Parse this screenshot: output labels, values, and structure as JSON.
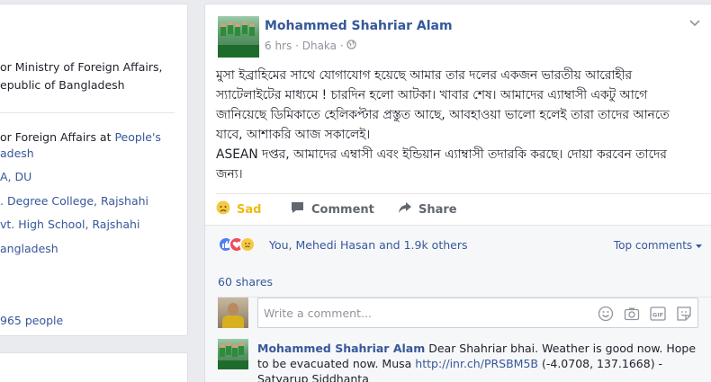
{
  "left_intro": {
    "lines": [
      {
        "text": "or Ministry of Foreign Affairs,",
        "link": ""
      },
      {
        "text": "epublic of Bangladesh",
        "link": ""
      },
      {
        "text": "or Foreign Affairs at ",
        "link": "People's"
      },
      {
        "text": "",
        "link": "adesh"
      },
      {
        "text": "",
        "link": "A, DU"
      },
      {
        "text": "",
        "link": ". Degree College, Rajshahi"
      },
      {
        "text": "",
        "link": "vt. High School, Rajshahi"
      },
      {
        "text": "",
        "link": "angladesh"
      },
      {
        "text": "",
        "link": "965 people"
      }
    ]
  },
  "post": {
    "author": "Mohammed Shahriar Alam",
    "time": "6 hrs",
    "location": "Dhaka",
    "body_lines": [
      "মুসা ইব্রাহিমের সাথে যোগাযোগ হয়েছে আমার তার দলের একজন ভারতীয় আরোহীর",
      "স্যাটেলাইটের মাধ্যমে ! চারদিন হলো আটকা। খাবার শেষ। আমাদের এ্যাম্বাসী একটু আগে",
      "জানিয়েছে ডিমিকাতে হেলিকপ্টার প্রস্তুত আছে, আবহাওয়া ভালো হলেই তারা তাদের আনতে",
      "যাবে, আশাকরি আজ সকালেই।",
      "ASEAN দপ্তর, আমাদের এম্বাসী এবং ইন্ডিয়ান এ্যাম্বাসী তদারকি করছে। দোয়া করবেন তাদের",
      "জন্য।"
    ],
    "actions": {
      "sad": "Sad",
      "comment": "Comment",
      "share": "Share"
    },
    "reactions_prefix": "You, ",
    "reactions_name": "Mehedi Hasan",
    "reactions_suffix": " and 1.9k others",
    "top_comments": "Top comments",
    "shares": "60 shares",
    "comment_placeholder": "Write a comment...",
    "comment": {
      "author": "Mohammed Shahriar Alam",
      "text_before": " Dear Shahriar bhai. Weather is good now. Hope to be evacuated now. Musa ",
      "link": "http://inr.ch/PRSBM5B",
      "text_after": " (-4.0708, 137.1668) - Satyarup Siddhanta"
    }
  },
  "colors": {
    "link": "#365899",
    "sad": "#f0ba15",
    "muted": "#90949c",
    "background": "#e9ebee"
  },
  "icons": [
    "globe-icon",
    "chevron-down-icon",
    "sad-reaction-icon",
    "comment-icon",
    "share-icon",
    "like-reaction-icon",
    "love-reaction-icon",
    "emoji-icon",
    "camera-icon",
    "gif-icon",
    "sticker-icon"
  ]
}
